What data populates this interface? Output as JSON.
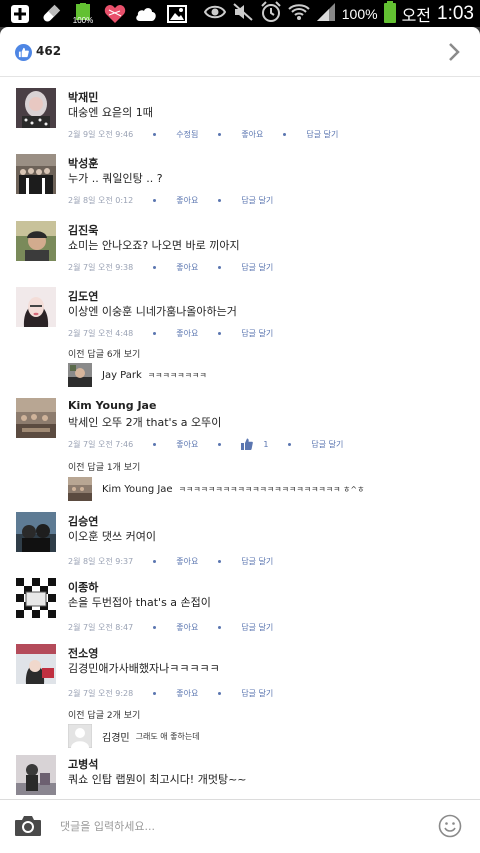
{
  "status_bar": {
    "battery_small_label": "100%",
    "battery_percent": "100%",
    "ampm": "오전",
    "time": "1:03"
  },
  "header": {
    "like_count": "462"
  },
  "comments": [
    {
      "author": "박재민",
      "text": "대숭엔 요읃의 1때",
      "time": "2월 9일 오전 9:46",
      "actions": [
        "수정됨",
        "좋아요",
        "답글 달기"
      ]
    },
    {
      "author": "박성훈",
      "text": "누가 .. 쿼일인탕 .. ?",
      "time": "2월 8일 오전 0:12",
      "actions": [
        "좋아요",
        "답글 달기"
      ]
    },
    {
      "author": "김진욱",
      "text": "쇼미는 안나오죠? 나오면 바로 끼아지",
      "time": "2월 7일 오전 9:38",
      "actions": [
        "좋아요",
        "답글 달기"
      ]
    },
    {
      "author": "김도연",
      "text": "이상엔 이숭훈 니네가훔나올아하는거",
      "time": "2월 7일 오전 4:48",
      "actions": [
        "좋아요",
        "답글 달기"
      ],
      "previous_replies": "이전 답글 6개 보기",
      "reply": {
        "author": "Jay Park",
        "text": "ㅋㅋㅋㅋㅋㅋㅋㅋ"
      }
    },
    {
      "author": "Kim Young Jae",
      "text": "박세인 오뚜 2개 that's a 오뚜이",
      "time": "2월 7일 오전 7:46",
      "actions": [
        "좋아요",
        "답글 달기"
      ],
      "like_count": "1",
      "previous_replies": "이전 답글 1개 보기",
      "reply": {
        "author": "Kim Young Jae",
        "text": "ㅋㅋㅋㅋㅋㅋㅋㅋㅋㅋㅋㅋㅋㅋㅋㅋㅋㅋㅋㅋㅋㅋ ㅎ^ㅎ"
      }
    },
    {
      "author": "김승연",
      "text": "이오훈 댓쓰 커여이",
      "time": "2월 8일 오전 9:37",
      "actions": [
        "좋아요",
        "답글 달기"
      ]
    },
    {
      "author": "이종하",
      "text": "손을 두번접아 that's a 손접이",
      "time": "2월 7일 오전 8:47",
      "actions": [
        "좋아요",
        "답글 달기"
      ]
    },
    {
      "author": "전소영",
      "text": "김경민애가사배했자나ㅋㅋㅋㅋㅋ",
      "time": "2월 7일 오전 9:28",
      "actions": [
        "좋아요",
        "답글 달기"
      ],
      "previous_replies": "이전 답글 2개 보기",
      "reply": {
        "author": "김경민",
        "text": "그래도 애 좋하는데"
      }
    },
    {
      "author": "고병석",
      "text": "쿼쇼 인탑 랩뭔이 최고시다! 개멋탕~~",
      "time": "",
      "actions": []
    }
  ],
  "footer": {
    "placeholder": "댓글을 입력하세요..."
  },
  "colors": {
    "like_blue": "#4e86e4",
    "action_blue": "#5b76b0",
    "battery_green": "#63c132"
  },
  "icons": [
    "plus-icon",
    "battery-saver-icon",
    "battery-widget-icon",
    "heart-icon",
    "cloud-icon",
    "image-icon",
    "eye-icon",
    "mute-icon",
    "alarm-icon",
    "wifi-icon",
    "signal-icon",
    "battery-icon",
    "like-icon",
    "chevron-right-icon",
    "camera-icon",
    "smiley-icon"
  ]
}
